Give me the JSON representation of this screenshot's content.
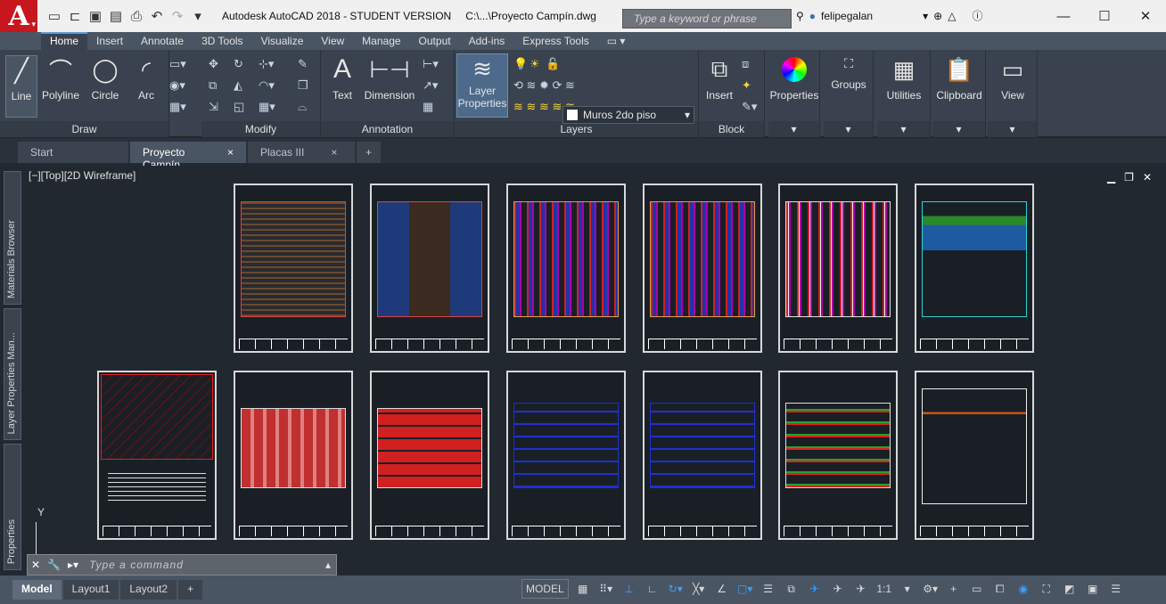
{
  "app": {
    "title": "Autodesk AutoCAD 2018 - STUDENT VERSION",
    "file_path": "C:\\...\\Proyecto Campín.dwg",
    "logo_letter": "A"
  },
  "search": {
    "placeholder": "Type a keyword or phrase"
  },
  "user": {
    "name": "felipegalan"
  },
  "ribbon_tabs": [
    "Home",
    "Insert",
    "Annotate",
    "3D Tools",
    "Visualize",
    "View",
    "Manage",
    "Output",
    "Add-ins",
    "Express Tools"
  ],
  "ribbon": {
    "draw": {
      "title": "Draw",
      "line": "Line",
      "polyline": "Polyline",
      "circle": "Circle",
      "arc": "Arc"
    },
    "modify": {
      "title": "Modify"
    },
    "annotation": {
      "title": "Annotation",
      "text": "Text",
      "dimension": "Dimension"
    },
    "layers": {
      "title": "Layers",
      "layer_properties_1": "Layer",
      "layer_properties_2": "Properties",
      "current_layer": "Muros 2do piso"
    },
    "block": {
      "title": "Block",
      "insert": "Insert"
    },
    "properties": "Properties",
    "groups": "Groups",
    "utilities": "Utilities",
    "clipboard": "Clipboard",
    "view": "View"
  },
  "doc_tabs": [
    {
      "label": "Start"
    },
    {
      "label": "Proyecto Campín",
      "close": "×"
    },
    {
      "label": "Placas III",
      "close": "×"
    },
    {
      "label": "+"
    }
  ],
  "side_palettes": [
    "Materials Browser",
    "Layer Properties Man...",
    "Properties"
  ],
  "viewport": {
    "label": "[−][Top][2D Wireframe]"
  },
  "ucs": {
    "y": "Y"
  },
  "command": {
    "placeholder": "Type a command"
  },
  "layout_tabs": [
    "Model",
    "Layout1",
    "Layout2",
    "+"
  ],
  "status": {
    "model": "MODEL",
    "scale": "1:1"
  },
  "colors": {
    "accent": "#3aa0ff",
    "logo": "#c8161e",
    "ribbon_bg": "#39424e",
    "canvas": "#212830"
  }
}
